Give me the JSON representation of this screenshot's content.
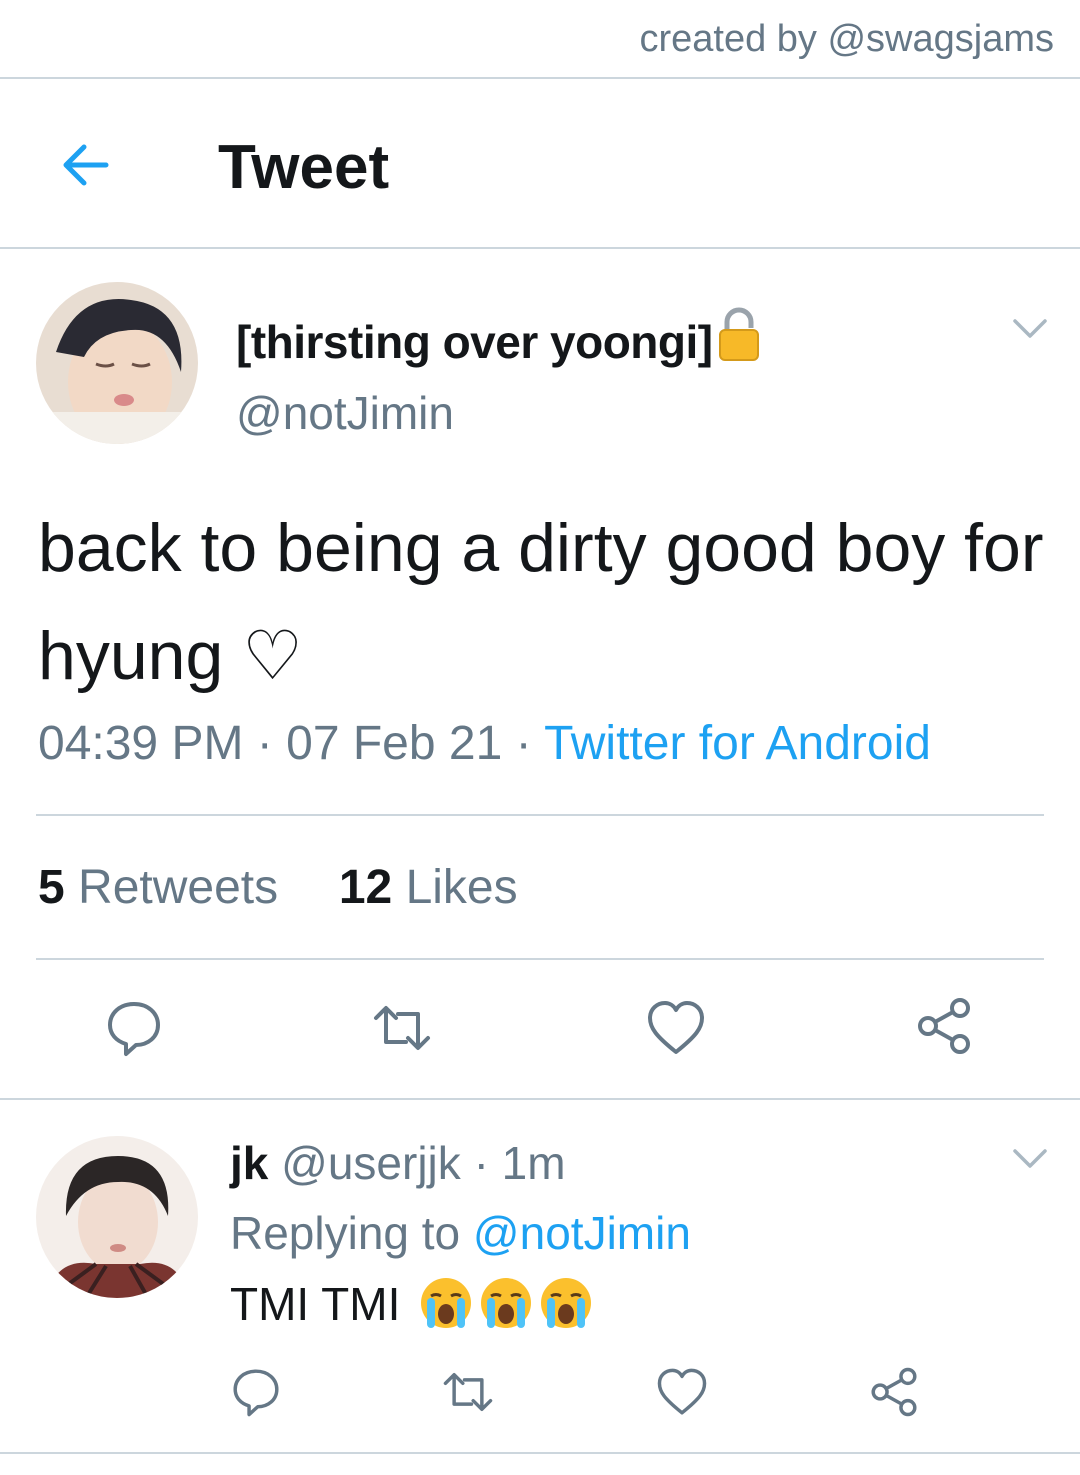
{
  "credit": "created by @swagsjams",
  "header": {
    "title": "Tweet"
  },
  "tweet": {
    "author_name": "[thirsting over yoongi]",
    "author_handle": "@notJimin",
    "text": "back to being a dirty good boy for hyung ♡",
    "time": "04:39 PM",
    "date": "07 Feb 21",
    "separator": "·",
    "source": "Twitter for Android",
    "retweets_count": "5",
    "retweets_label": "Retweets",
    "likes_count": "12",
    "likes_label": "Likes"
  },
  "reply": {
    "author_name": "jk",
    "author_handle": "@userjjk",
    "separator": "·",
    "time": "1m",
    "replying_label": "Replying to",
    "replying_handle": "@notJimin",
    "text": "TMI TMI"
  },
  "icons": [
    "back-arrow-icon",
    "lock-icon",
    "chevron-down-icon",
    "reply-icon",
    "retweet-icon",
    "like-icon",
    "share-icon",
    "crying-face-emoji"
  ],
  "colors": {
    "accent": "#1da1f2",
    "secondary_text": "#657786",
    "divider": "#ccd6dd",
    "text": "#14171a"
  }
}
